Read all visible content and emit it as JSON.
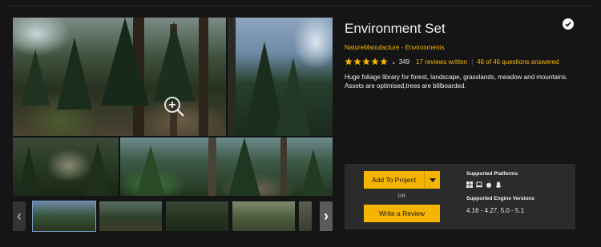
{
  "product": {
    "title": "Environment Set",
    "publisher": "NatureManufacture - Environments",
    "rating": {
      "stars": 5,
      "max_stars": 5,
      "count": "349",
      "reviews_link": "17 reviews written",
      "separator": "|",
      "questions_link": "46 of 46 questions answered"
    },
    "description": "Huge foliage library for forest, landscape, grasslands, meadow and mountains. Assets are optimised,trees are blilboarded."
  },
  "gallery": {
    "zoom_icon": "magnifier-plus-icon",
    "prev_icon": "chevron-left-icon",
    "next_icon": "chevron-right-icon",
    "prev_glyph": "‹",
    "next_glyph": "›",
    "thumbnails": 5
  },
  "purchase": {
    "add_label": "Add To Project",
    "or_label": "OR",
    "review_label": "Write a Review",
    "platforms_title": "Supported Platforms",
    "platform_icons": [
      "windows-icon",
      "laptop-icon",
      "apple-icon",
      "linux-icon"
    ],
    "engine_title": "Supported Engine Versions",
    "engine_versions": "4.16 - 4.27, 5.0 - 5.1"
  },
  "colors": {
    "accent": "#f5b400",
    "background": "#151515",
    "panel": "#2b2b2b"
  }
}
